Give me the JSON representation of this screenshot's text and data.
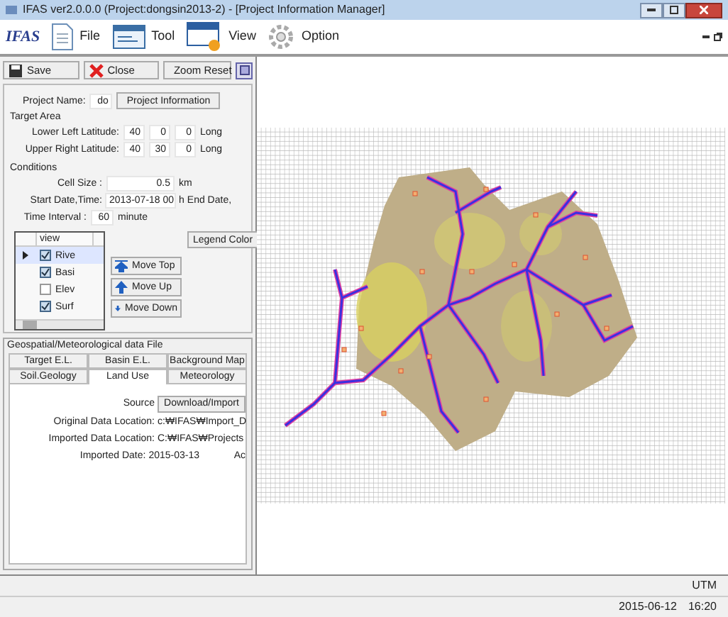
{
  "window": {
    "title": "IFAS ver2.0.0.0 (Project:dongsin2013-2) - [Project Information Manager]"
  },
  "logo": "IFAS",
  "menu": [
    {
      "label": "File",
      "kind": "file"
    },
    {
      "label": "Tool",
      "kind": "tool"
    },
    {
      "label": "View",
      "kind": "view"
    },
    {
      "label": "Option",
      "kind": "option"
    }
  ],
  "toolbar": [
    {
      "label": "Save",
      "kind": "save"
    },
    {
      "label": "Close",
      "kind": "close"
    },
    {
      "label": "Zoom Reset",
      "kind": "zoom"
    }
  ],
  "project": {
    "name_label": "Project Name:",
    "name_value": "do",
    "info_button": "Project Information",
    "target_area_label": "Target Area",
    "coords": [
      {
        "label": "Lower Left Latitude:",
        "values": [
          "40",
          "0",
          "0"
        ],
        "next": "Long"
      },
      {
        "label": "Upper Right Latitude:",
        "values": [
          "40",
          "30",
          "0"
        ],
        "next": "Long"
      }
    ],
    "conditions_label": "Conditions",
    "cell_size": {
      "label": "Cell Size :",
      "value": "0.5",
      "unit": "km"
    },
    "start": {
      "label": "Start Date,Time:",
      "value": "2013-07-18 00",
      "unit": "h",
      "next": "End Date,"
    },
    "interval": {
      "label": "Time Interval :",
      "value": "60",
      "unit": "minute"
    }
  },
  "layers": {
    "header": "view",
    "rows": [
      {
        "name": "Rive",
        "checked": true,
        "selected": true
      },
      {
        "name": "Basi",
        "checked": true,
        "selected": false
      },
      {
        "name": "Elev",
        "checked": false,
        "selected": false
      },
      {
        "name": "Surf",
        "checked": true,
        "selected": false
      }
    ]
  },
  "legend_button": "Legend Color",
  "order_buttons": [
    {
      "label": "Move Top",
      "kind": "top"
    },
    {
      "label": "Move Up",
      "kind": "up"
    },
    {
      "label": "Move Down",
      "kind": "down"
    }
  ],
  "data_panel": {
    "title": "Geospatial/Meteorological data File",
    "tabs": [
      [
        {
          "label": "Target E.L.",
          "selected": false
        },
        {
          "label": "Basin E.L.",
          "selected": false
        },
        {
          "label": "Background Map",
          "selected": false
        }
      ],
      [
        {
          "label": "Soil.Geology",
          "selected": false
        },
        {
          "label": "Land Use",
          "selected": true
        },
        {
          "label": "Meteorology",
          "selected": false
        }
      ]
    ],
    "source_label": "Source",
    "source_button": "Download/Import",
    "rows": [
      {
        "label": "Original Data Location:",
        "value": "c:₩IFAS₩Import_D"
      },
      {
        "label": "Imported Data Location:",
        "value": "C:₩IFAS₩Projects"
      },
      {
        "label": "Imported Date:",
        "value": "2015-03-13",
        "extra": "Ac"
      }
    ]
  },
  "status": {
    "projection": "UTM",
    "date": "2015-06-12",
    "time": "16:20"
  }
}
